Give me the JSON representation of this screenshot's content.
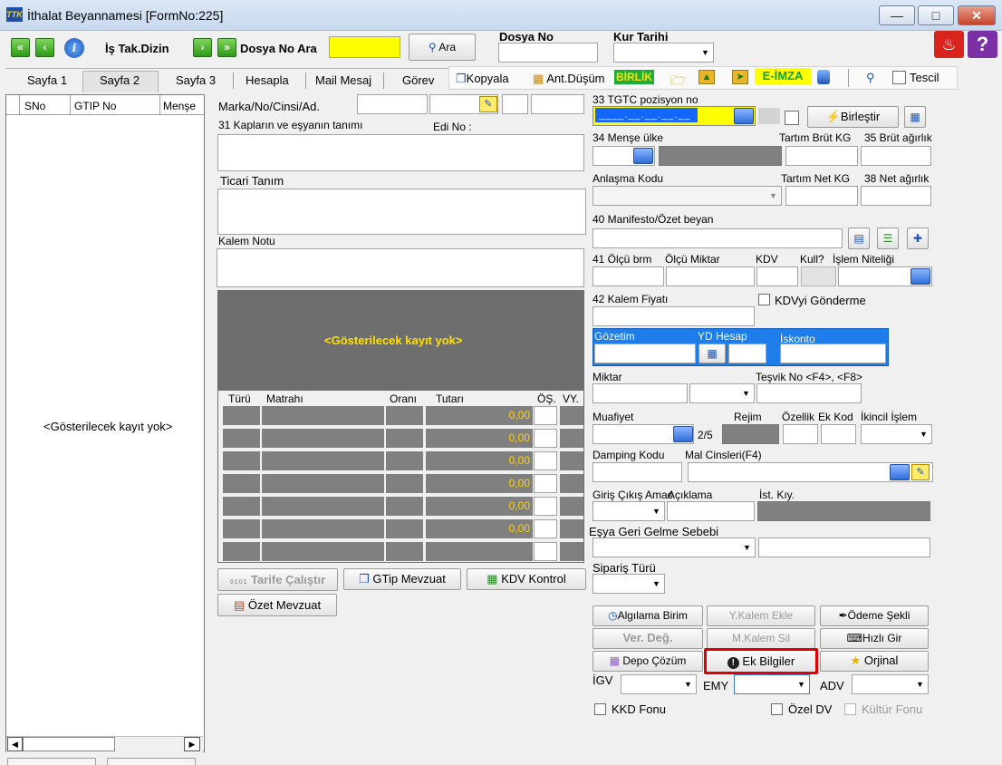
{
  "window": {
    "title": "İthalat Beyannamesi [FormNo:225]",
    "app_icon": "TTK"
  },
  "toolbar": {
    "is_tak_dizin": "İş Tak.Dizin",
    "dosya_no_ara": "Dosya No Ara",
    "ara_button": "Ara",
    "dosya_no_label": "Dosya No",
    "kur_tarihi_label": "Kur Tarihi"
  },
  "tabs": [
    {
      "label": "Sayfa 1"
    },
    {
      "label": "Sayfa 2"
    },
    {
      "label": "Sayfa 3"
    },
    {
      "label": "Hesapla"
    },
    {
      "label": "Mail Mesaj"
    },
    {
      "label": "Görev"
    }
  ],
  "tab_actions": {
    "kopyala": "Kopyala",
    "ant_dusum": "Ant.Düşüm",
    "birlik": "BİRLİK",
    "e_imza": "E-İMZA",
    "tescil": "Tescil"
  },
  "list": {
    "col_sno": "SNo",
    "col_gtip": "GTIP No",
    "col_mense": "Menşe",
    "empty": "<Gösterilecek kayıt yok>"
  },
  "mid": {
    "marka_label": "Marka/No/Cinsi/Ad.",
    "kaplar_label": "31 Kapların ve eşyanın tanımı",
    "edi_no_label": "Edi No :",
    "ticari_tanim_label": "Ticari Tanım",
    "kalem_notu_label": "Kalem Notu",
    "grid_empty": "<Gösterilecek kayıt yok>",
    "tax_cols": [
      "Türü",
      "Matrahı",
      "Oranı",
      "Tutarı",
      "ÖŞ.",
      "VY."
    ],
    "tax_values": [
      "0,00",
      "0,00",
      "0,00",
      "0,00",
      "0,00",
      "0,00",
      ""
    ],
    "tarife_btn": "Tarife Çalıştır",
    "tarife_prefix": "0101",
    "gtip_mevzuat_btn": "GTip Mevzuat",
    "kdv_kontrol_btn": "KDV Kontrol",
    "ozet_mevzuat_btn": "Özet Mevzuat"
  },
  "right": {
    "tgtc_label": "33 TGTC pozisyon no",
    "tgtc_mask": "____.__.__.__.__",
    "birlestir_btn": "Birleştir",
    "mense_label": "34 Menşe ülke",
    "tartim_brut_label": "Tartım Brüt KG",
    "brut_label": "35 Brüt ağırlık",
    "anlasma_label": "Anlaşma Kodu",
    "tartim_net_label": "Tartım Net KG",
    "net_label": "38 Net ağırlık",
    "manifesto_label": "40 Manifesto/Özet beyan",
    "olcu_brm_label": "41 Ölçü brm",
    "olcu_miktar_label": "Ölçü Miktar",
    "kdv_label": "KDV",
    "kull_label": "Kull?",
    "islem_niteligi_label": "İşlem Niteliği",
    "kalem_fiyati_label": "42 Kalem Fiyatı",
    "kdv_gonderme_label": "KDVyi Gönderme",
    "gozetim_label": "Gözetim",
    "yd_hesap_label": "YD Hesap",
    "iskonto_label": "İskonto",
    "miktar_label": "Miktar",
    "tesvik_label": "Teşvik No <F4>, <F8>",
    "muafiyet_label": "Muafiyet",
    "muafiyet_count": "2/5",
    "rejim_label": "Rejim",
    "ozellik_label": "Özellik",
    "ek_kod_label": "Ek Kod",
    "ikincil_label": "İkincil İşlem",
    "damping_label": "Damping Kodu",
    "mal_cinsleri_label": "Mal Cinsleri(F4)",
    "giris_cikis_label": "Giriş Çıkış Amac",
    "aciklama_label": "Açıklama",
    "ist_kiy_label": "İst. Kıy.",
    "esya_geri_label": "Eşya Geri Gelme Sebebi",
    "siparis_label": "Sipariş Türü"
  },
  "actions": {
    "algilama": "Algılama Birim",
    "y_kalem_ekle": "Y.Kalem Ekle",
    "odeme_sekli": "Ödeme Şekli",
    "ver_deg": "Ver. Değ.",
    "m_kalem_sil": "M.Kalem Sil",
    "hizli_gir": "Hızlı Gir",
    "depo_cozum": "Depo Çözüm",
    "ek_bilgiler": "Ek Bilgiler",
    "orjinal": "Orjinal",
    "igv": "İGV",
    "emy": "EMY",
    "adv": "ADV",
    "kkd_fonu": "KKD Fonu",
    "ozel_dv": "Özel DV",
    "kultur_fonu": "Kültür Fonu"
  }
}
